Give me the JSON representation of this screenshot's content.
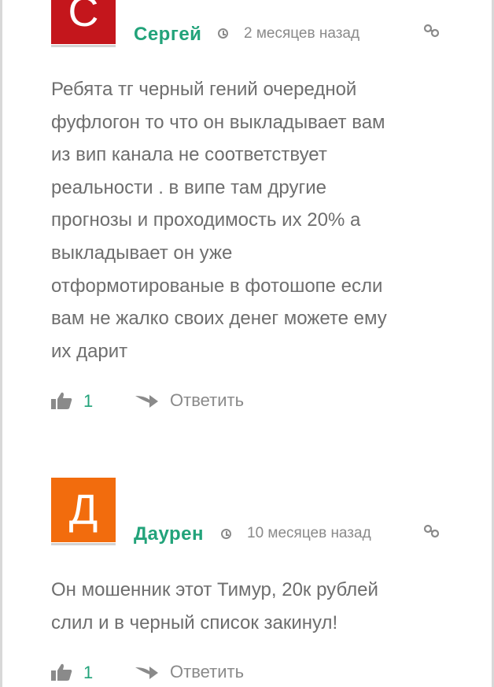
{
  "comments": [
    {
      "avatar_letter": "С",
      "avatar_color": "#c4161c",
      "author": "Сергей",
      "date": "2 месяцев назад",
      "lines": [
        "Ребята тг черный гений очередной",
        "фуфлогон то что он выкладывает вам",
        "из вип канала не соответствует",
        "реальности . в випе там другие",
        "прогнозы и проходимость их 20% а",
        "выкладывает он уже",
        "отформотированые в фотошопе если",
        "вам не жалко своих денег можете ему",
        "их дарит"
      ],
      "likes": "1",
      "reply_label": "Ответить"
    },
    {
      "avatar_letter": "Д",
      "avatar_color": "#f26c0d",
      "author": "Даурен",
      "date": "10 месяцев назад",
      "lines": [
        "Он мошенник этот Тимур, 20к рублей",
        "слил и в черный список закинул!"
      ],
      "likes": "1",
      "reply_label": "Ответить"
    }
  ],
  "icons": {
    "time": "clock-icon",
    "permalink": "link-icon",
    "like": "thumbs-up-icon",
    "reply": "reply-arrow-icon"
  },
  "colors": {
    "accent": "#22a37a",
    "text": "#6e6e6e",
    "meta": "#8a8a8a"
  }
}
